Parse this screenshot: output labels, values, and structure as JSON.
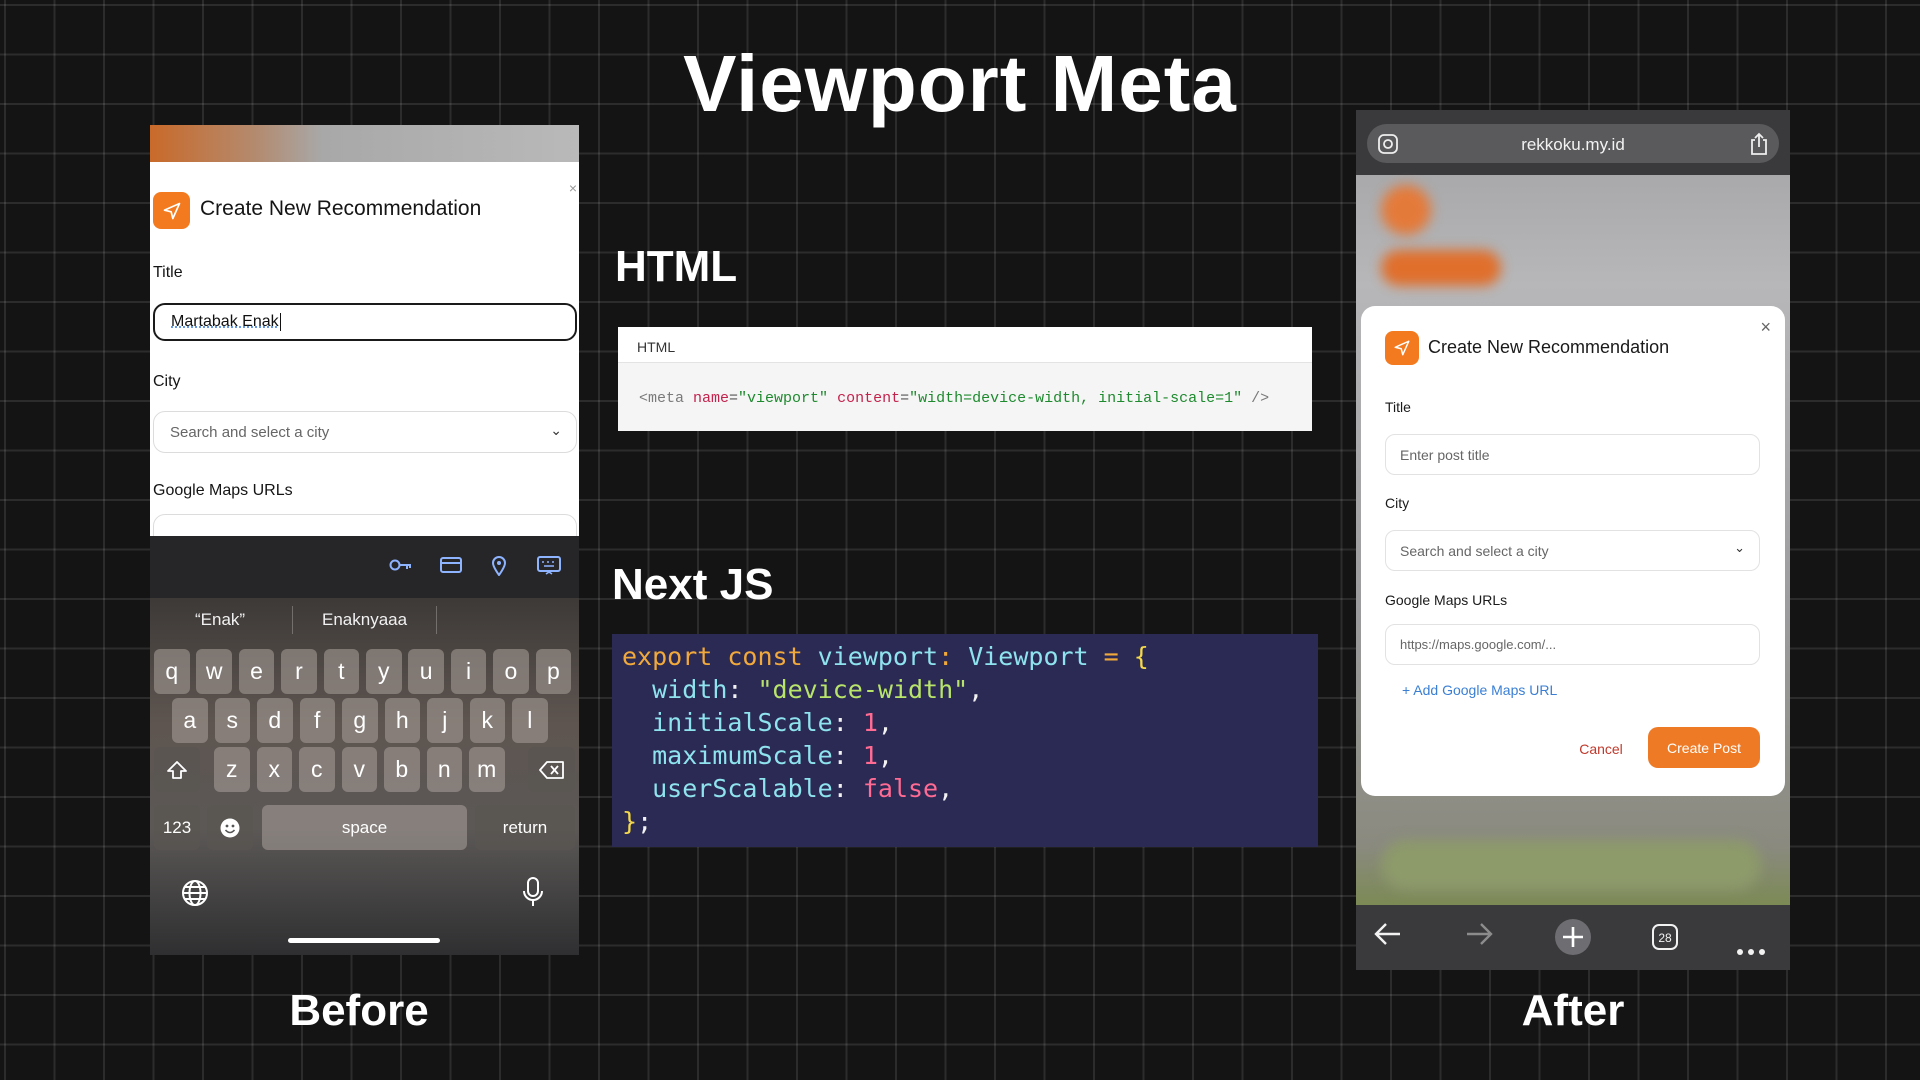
{
  "page": {
    "main_title": "Viewport Meta",
    "html_heading": "HTML",
    "nextjs_heading": "Next JS",
    "before_caption": "Before",
    "after_caption": "After"
  },
  "before": {
    "modal_title": "Create New Recommendation",
    "title_label": "Title",
    "title_value": "Martabak Enak",
    "city_label": "City",
    "city_placeholder": "Search and select a city",
    "maps_label": "Google Maps URLs",
    "suggestions": [
      "“Enak”",
      "Enaknyaaa"
    ],
    "keyboard": {
      "row1": [
        "q",
        "w",
        "e",
        "r",
        "t",
        "y",
        "u",
        "i",
        "o",
        "p"
      ],
      "row2": [
        "a",
        "s",
        "d",
        "f",
        "g",
        "h",
        "j",
        "k",
        "l"
      ],
      "row3": [
        "z",
        "x",
        "c",
        "v",
        "b",
        "n",
        "m"
      ],
      "numbers_key": "123",
      "space_key": "space",
      "return_key": "return"
    }
  },
  "html_code": {
    "tab_label": "HTML",
    "tag_open": "<meta ",
    "attr_name": "name",
    "eq1": "=",
    "val_name": "\"viewport\"",
    "attr_content": " content",
    "eq2": "=",
    "val_content": "\"width=device-width, initial-scale=1\"",
    "tag_close": " />"
  },
  "js_code": {
    "l1_kw": "export const ",
    "l1_id": "viewport",
    "l1_colon": ": ",
    "l1_type": "Viewport",
    "l1_eq": " = ",
    "l1_brace": "{",
    "l2_key": "width",
    "l2_sep": ": ",
    "l2_val": "\"device-width\"",
    "l2_end": ",",
    "l3_key": "initialScale",
    "l3_sep": ": ",
    "l3_val": "1",
    "l3_end": ",",
    "l4_key": "maximumScale",
    "l4_sep": ": ",
    "l4_val": "1",
    "l4_end": ",",
    "l5_key": "userScalable",
    "l5_sep": ": ",
    "l5_val": "false",
    "l5_end": ",",
    "l6_brace": "}",
    "l6_end": ";"
  },
  "after": {
    "url": "rekkoku.my.id",
    "modal_title": "Create New Recommendation",
    "title_label": "Title",
    "title_placeholder": "Enter post title",
    "city_label": "City",
    "city_placeholder": "Search and select a city",
    "maps_label": "Google Maps URLs",
    "maps_placeholder": "https://maps.google.com/...",
    "add_link": "+ Add Google Maps URL",
    "cancel_label": "Cancel",
    "create_label": "Create Post",
    "tab_count": "28"
  },
  "colors": {
    "accent": "#f47a1f",
    "js_background": "#2a2a55"
  }
}
